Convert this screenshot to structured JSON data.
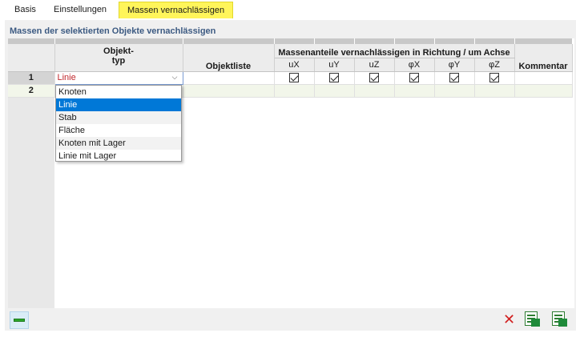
{
  "tabs": [
    {
      "label": "Basis"
    },
    {
      "label": "Einstellungen"
    },
    {
      "label": "Massen vernachlässigen"
    }
  ],
  "section_title": "Massen der selektierten Objekte vernachlässigen",
  "columns": {
    "objekttyp_line1": "Objekt-",
    "objekttyp_line2": "typ",
    "objektliste": "Objektliste",
    "group_header": "Massenanteile vernachlässigen in Richtung / um Achse",
    "sub": [
      "uX",
      "uY",
      "uZ",
      "φX",
      "φY",
      "φZ"
    ],
    "kommentar": "Kommentar"
  },
  "rows": [
    {
      "num": "1",
      "objekttyp": "Linie",
      "objektliste": "",
      "checks": [
        true,
        true,
        true,
        true,
        true,
        true
      ],
      "kommentar": ""
    },
    {
      "num": "2",
      "objekttyp": "",
      "objektliste": "",
      "checks": [
        false,
        false,
        false,
        false,
        false,
        false
      ],
      "kommentar": ""
    }
  ],
  "dropdown": {
    "options": [
      "Knoten",
      "Linie",
      "Stab",
      "Fläche",
      "Knoten mit Lager",
      "Linie mit Lager"
    ],
    "selected": "Linie"
  },
  "icons": {
    "bottom_left": "ruler-icon",
    "delete": "delete-x-icon",
    "export": "excel-export-icon",
    "import": "excel-import-icon"
  },
  "colors": {
    "active_tab": "#fff55a",
    "selected_value": "#c0282d",
    "selection_highlight": "#0078d7",
    "section_title": "#3c5a82"
  }
}
